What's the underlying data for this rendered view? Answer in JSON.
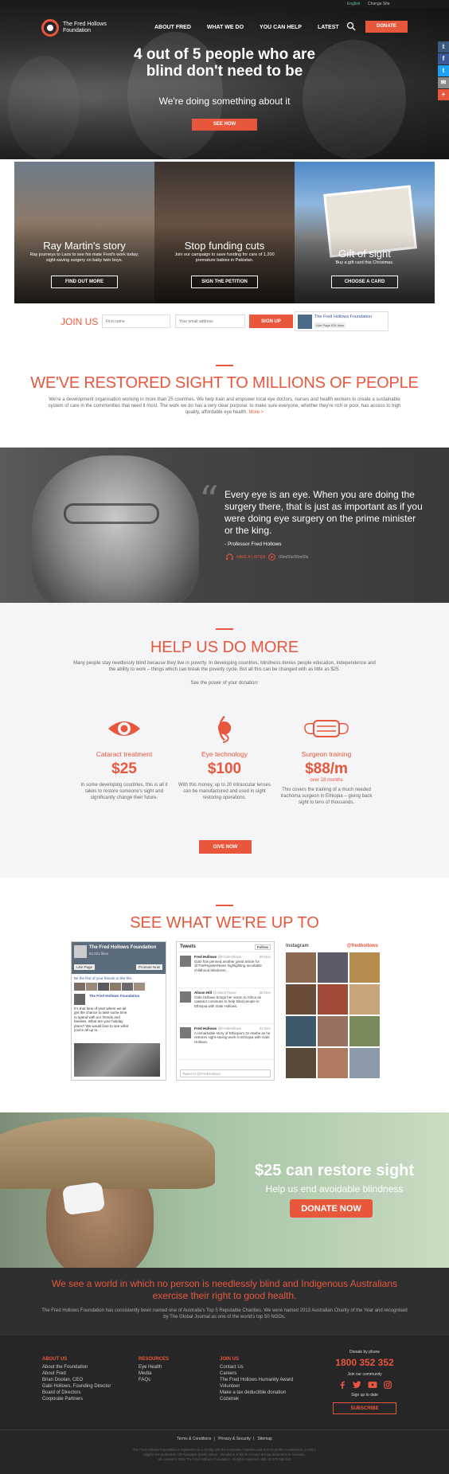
{
  "topbar": {
    "english": "English",
    "change_site": "Change Site"
  },
  "header": {
    "logo_line1": "The Fred Hollows",
    "logo_line2": "Foundation",
    "nav": [
      "ABOUT FRED",
      "WHAT WE DO",
      "YOU CAN HELP",
      "LATEST"
    ],
    "donate": "DONATE"
  },
  "share": [
    "t",
    "f",
    "t",
    "✉",
    "+"
  ],
  "hero": {
    "title_line1": "4 out of 5 people who are",
    "title_line2": "blind don't need to be",
    "subtitle": "We're doing something about it",
    "cta": "SEE HOW"
  },
  "tiles": [
    {
      "title": "Ray Martin's story",
      "text": "Ray journeys to Laos to see his mate Fred's work today; sight-saving surgery on baby twin boys.",
      "button": "FIND OUT MORE"
    },
    {
      "title": "Stop funding cuts",
      "text": "Join our campaign to save funding for care of 1,200 premature babies in Pakistan.",
      "button": "SIGN THE PETITION"
    },
    {
      "title": "Gift of sight",
      "text": "Buy a gift card this Christmas.",
      "button": "CHOOSE A CARD"
    }
  ],
  "join": {
    "label": "JOIN US",
    "first_name_placeholder": "First name",
    "email_placeholder": "Your email address",
    "button": "SIGN UP",
    "fb_name": "The Fred Hollows Foundation",
    "fb_like": "Like Page",
    "fb_count": "62K likes"
  },
  "restored": {
    "title": "WE'VE RESTORED SIGHT TO MILLIONS OF PEOPLE",
    "body": "We're a development organisation working in more than 25 countries. We help train and empower local eye doctors, nurses and health workers to create a sustainable system of care in the communities that need it most. The work we do has a very clear purpose: to make sure everyone, whether they're rich or poor, has access to high quality, affordable eye health.",
    "more": "More >"
  },
  "quote": {
    "text": "Every eye is an eye. When you are doing the surgery there, that is just as important as if you were doing eye surgery on the prime minister or the king.",
    "attribution": "- Professor Fred Hollows",
    "listen": "HAVE A LISTEN",
    "duration": "00m00s/00m09s"
  },
  "help": {
    "title": "HELP US DO MORE",
    "intro": "Many people stay needlessly blind because they live in poverty. In developing countries, blindness denies people education, independence and the ability to work – things which can break the poverty cycle. But all this can be changed with as little as $25.",
    "power": "See the power of your donation:",
    "items": [
      {
        "name": "Cataract treatment",
        "amount": "$25",
        "per": "",
        "desc": "In some developing countries, this is all it takes to restore someone's sight and significantly change their future."
      },
      {
        "name": "Eye technology",
        "amount": "$100",
        "per": "",
        "desc": "With this money, up to 20 intraocular lenses can be manufactured and used in sight restoring operations."
      },
      {
        "name": "Surgeon training",
        "amount": "$88/m",
        "per": "over 18 months",
        "desc": "This covers the training of a much needed trachoma surgeon in Ethiopia – giving back sight to tens of thousands."
      }
    ],
    "give": "GIVE NOW"
  },
  "social": {
    "title": "SEE WHAT WE'RE UP TO",
    "fb_title": "The Fred Hollows Foundation",
    "fb_likes": "62,021 likes",
    "fb_like_btn": "Like Page",
    "fb_promote": "Promote Now",
    "fb_friends": "Be the first of your friends to like this",
    "fb_post_name": "The Fred Hollows Foundation",
    "fb_post_text": "It's that time of year where we all get the chance to take some time to spend with our friends and families. What are your holiday plans? We would love to see what you're all up to.",
    "tw_title": "Tweets",
    "tw_follow": "Follow",
    "tweets": [
      {
        "name": "Fred Hollows",
        "handle": "@FredHollows",
        "date": "29 Dec",
        "text": "Gabi has penned another great article for @TheRegisterNews highlighting avoidable childhood blindness."
      },
      {
        "name": "Alison Hill",
        "handle": "@AlisonTravel",
        "date": "28 Dec",
        "text": "Gabi Hollows brings her vision to Africa as cataract continues to help blind people in Ethiopia with Gabi Hollows."
      },
      {
        "name": "Fred Hollows",
        "handle": "@FredHollows",
        "date": "24 Dec",
        "text": "A remarkable story of Ethiopia's Dr Abebe as he restores sight-saving work in Ethiopia with Gabi Hollows."
      }
    ],
    "tw_input": "Tweet to @FredHollows",
    "ig_title": "Instagram",
    "ig_handle": "@fredhollows"
  },
  "bottom_hero": {
    "title": "$25 can restore sight",
    "subtitle": "Help us end avoidable blindness",
    "button": "DONATE NOW"
  },
  "vision": {
    "title": "We see a world in which no person is needlessly blind and Indigenous Australians exercise their right to good health.",
    "text": "The Fred Hollows Foundation has consistently been named one of Australia's Top 5 Reputable Charities. We were named 2013 Australian Charity of the Year and recognised by The Global Journal as one of the world's top 50 NGOs."
  },
  "footer": {
    "about": {
      "heading": "ABOUT US",
      "links": [
        "About the Foundation",
        "About Fred",
        "Brian Doolan, CEO",
        "Gabi Hollows, Founding Director",
        "Board of Directors",
        "Corporate Partners"
      ]
    },
    "resources": {
      "heading": "RESOURCES",
      "links": [
        "Eye Health",
        "Media",
        "FAQs"
      ]
    },
    "join": {
      "heading": "JOIN US",
      "links": [
        "Contact Us",
        "Careers",
        "The Fred Hollows Humanity Award",
        "Volunteer",
        "Make a tax deductible donation",
        "Cozetrek"
      ]
    },
    "donate_phone_label": "Donate by phone",
    "phone": "1800 352 352",
    "community": "Join our community",
    "stay": "Sign up to date",
    "subscribe": "SUBSCRIBE",
    "links": [
      "Terms & Conditions",
      "Privacy & Security",
      "Sitemap"
    ],
    "legal1": "The Fred Hollows Foundation is registered as a charity with the Australian Charities and Not-for-profits Commission (ACNC).",
    "legal2": "Eligible tax-deductible Gift Recipient (DGR) status - donations of $2.00 or more are tax deductible in Australia.",
    "legal3": "All content © 2015 The Fred Hollows Foundation. All rights reserved. ABN 46 070 556 642"
  },
  "colors": {
    "accent": "#e8573c",
    "dark": "#2f2f31",
    "light_bg": "#f5f4f6"
  }
}
